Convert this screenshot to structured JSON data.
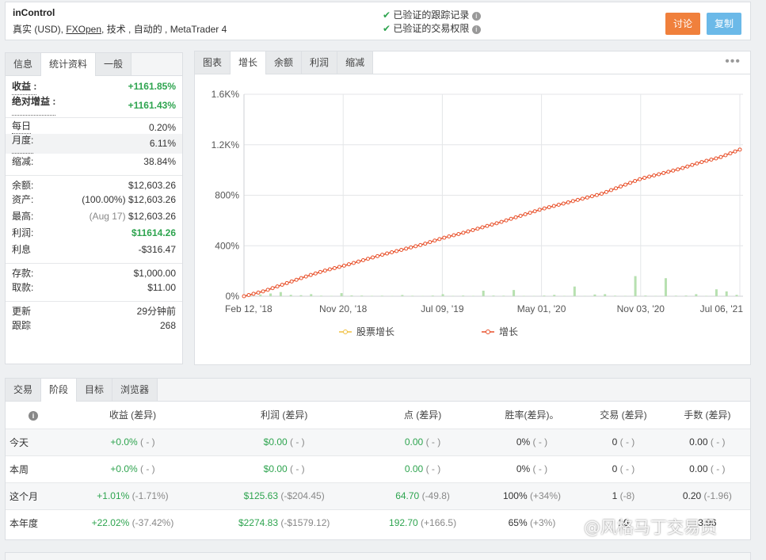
{
  "header": {
    "title": "inControl",
    "subtitle_prefix": "真实 (USD), ",
    "broker": "FXOpen",
    "subtitle_suffix": ", 技术 , 自动的 , MetaTrader 4",
    "verified_track": "已验证的跟踪记录",
    "verified_trading": "已验证的交易权限",
    "discuss_label": "讨论",
    "copy_label": "复制",
    "discuss_color": "#f0803c",
    "copy_color": "#6bb9e8"
  },
  "left_tabs": [
    "信息",
    "统计资料",
    "一般"
  ],
  "stats": {
    "gain_label": "收益 :",
    "gain_value": "+1161.85%",
    "abs_gain_label": "绝对增益 :",
    "abs_gain_value": "+1161.43%",
    "daily_label": "每日",
    "daily_value": "0.20%",
    "monthly_label": "月度:",
    "monthly_value": "6.11%",
    "drawdown_label": "缩减:",
    "drawdown_value": "38.84%",
    "balance_label": "余额:",
    "balance_value": "$12,603.26",
    "equity_label": "资产:",
    "equity_pct": "(100.00%)",
    "equity_value": "$12,603.26",
    "highest_label": "最高:",
    "highest_date": "(Aug 17)",
    "highest_value": "$12,603.26",
    "profit_label": "利润:",
    "profit_value": "$11614.26",
    "interest_label": "利息",
    "interest_value": "-$316.47",
    "deposits_label": "存款:",
    "deposits_value": "$1,000.00",
    "withdrawals_label": "取款:",
    "withdrawals_value": "$11.00",
    "updated_label": "更新",
    "updated_value": "29分钟前",
    "tracking_label": "跟踪",
    "tracking_value": "268"
  },
  "chart_tabs": [
    "图表",
    "增长",
    "余额",
    "利润",
    "缩减"
  ],
  "chart_menu_icon": "more-dots-icon",
  "chart_data": {
    "type": "line",
    "y_ticks": [
      "1.6K%",
      "1.2K%",
      "800%",
      "400%",
      "0%"
    ],
    "ylim": [
      0,
      1600
    ],
    "x_ticks": [
      "Feb 12, '18",
      "Nov 20, '18",
      "Jul 09, '19",
      "May 01, '20",
      "Nov 03, '20",
      "Jul 06, '21"
    ],
    "legend": [
      "股票增长",
      "增长"
    ],
    "series": [
      {
        "name": "增长",
        "color": "#e8502a",
        "values": [
          0,
          40,
          95,
          150,
          200,
          240,
          285,
          330,
          370,
          410,
          460,
          500,
          545,
          590,
          640,
          690,
          730,
          770,
          810,
          870,
          930,
          970,
          1010,
          1060,
          1100,
          1161.85
        ]
      },
      {
        "name": "股票增长",
        "color": "#f0c040",
        "values": [
          0,
          40,
          95,
          150,
          200,
          240,
          285,
          330,
          370,
          410,
          460,
          500,
          545,
          590,
          640,
          690,
          730,
          770,
          810,
          870,
          930,
          970,
          1010,
          1060,
          1100,
          1161.85
        ]
      }
    ],
    "bar_color": "#b7e0b0",
    "bars": [
      10,
      25,
      40,
      60,
      20,
      15,
      30,
      8,
      5,
      45,
      12,
      10,
      6,
      8,
      5,
      18,
      7,
      4,
      10,
      30,
      5,
      10,
      6,
      80,
      10,
      8,
      90,
      6,
      4,
      10,
      20,
      6,
      140,
      5,
      25,
      30,
      8,
      6,
      290,
      10,
      5,
      260,
      8,
      10,
      30,
      6,
      100,
      70,
      20
    ]
  },
  "bottom_tabs": [
    "交易",
    "阶段",
    "目标",
    "浏览器"
  ],
  "period_table": {
    "info_icon": "info-icon",
    "headers": [
      "收益 (差异)",
      "利润 (差异)",
      "点 (差异)",
      "胜率(差异)。",
      "交易 (差异)",
      "手数 (差异)"
    ],
    "rows": [
      {
        "label": "今天",
        "cells": [
          [
            "+0.0%",
            "( - )"
          ],
          [
            "$0.00",
            "( - )"
          ],
          [
            "0.00",
            "( - )"
          ],
          [
            "0%",
            "( - )"
          ],
          [
            "0",
            "( - )"
          ],
          [
            "0.00",
            "( - )"
          ]
        ]
      },
      {
        "label": "本周",
        "cells": [
          [
            "+0.0%",
            "( - )"
          ],
          [
            "$0.00",
            "( - )"
          ],
          [
            "0.00",
            "( - )"
          ],
          [
            "0%",
            "( - )"
          ],
          [
            "0",
            "( - )"
          ],
          [
            "0.00",
            "( - )"
          ]
        ]
      },
      {
        "label": "这个月",
        "cells": [
          [
            "+1.01%",
            "(-1.71%)"
          ],
          [
            "$125.63",
            "(-$204.45)"
          ],
          [
            "64.70",
            "(-49.8)"
          ],
          [
            "100%",
            "(+34%)"
          ],
          [
            "1",
            "(-8)"
          ],
          [
            "0.20",
            "(-1.96)"
          ]
        ]
      },
      {
        "label": "本年度",
        "cells": [
          [
            "+22.02%",
            "(-37.42%)"
          ],
          [
            "$2274.83",
            "(-$1579.12)"
          ],
          [
            "192.70",
            "(+166.5)"
          ],
          [
            "65%",
            "(+3%)"
          ],
          [
            "10",
            ""
          ],
          [
            "3.96",
            ""
          ]
        ]
      }
    ],
    "green_cols": [
      0,
      1,
      2
    ]
  },
  "watermark": "@风格马丁交易员"
}
